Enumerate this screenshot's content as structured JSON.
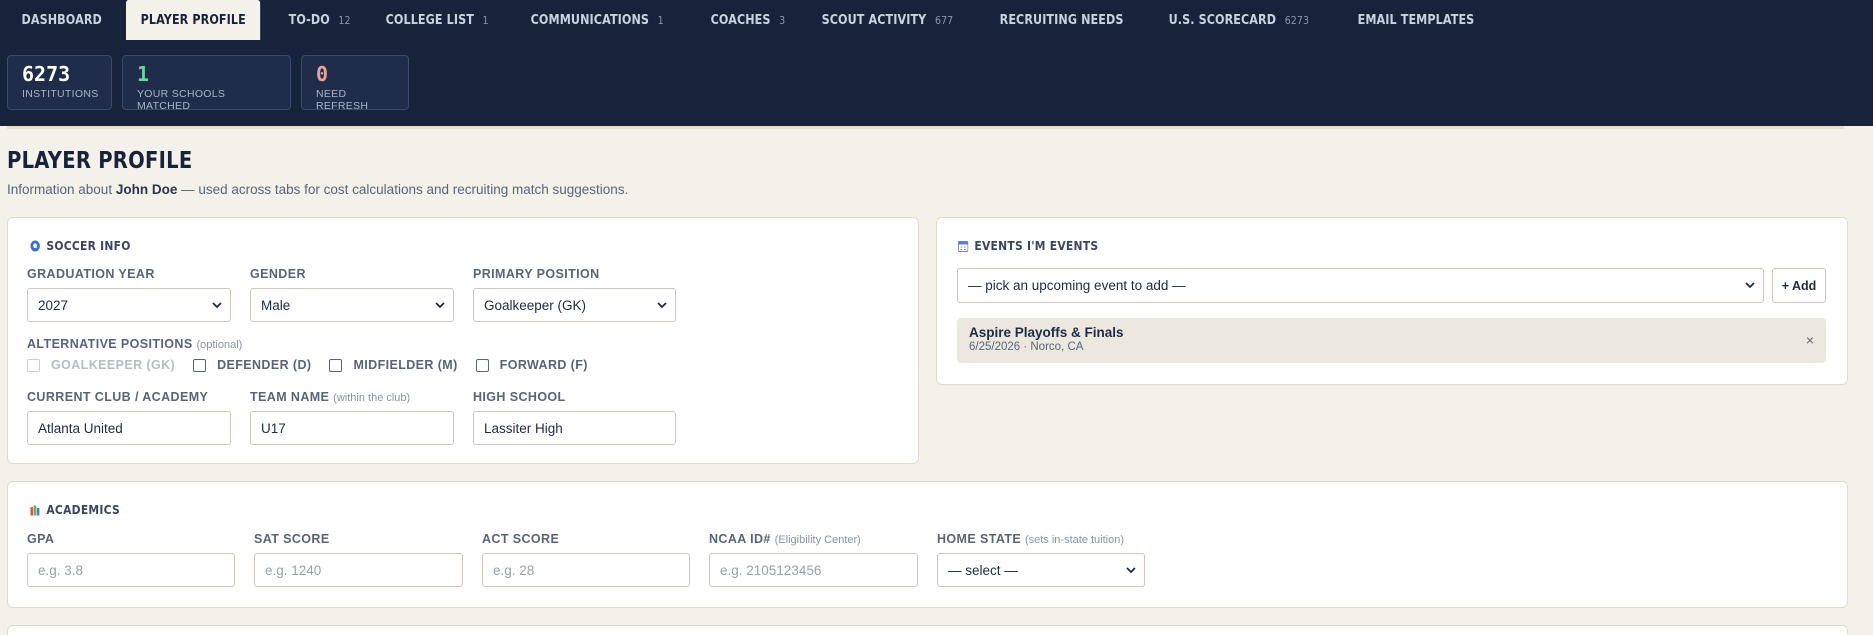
{
  "nav": {
    "tabs": [
      {
        "label": "DASHBOARD",
        "count": ""
      },
      {
        "label": "PLAYER PROFILE",
        "count": ""
      },
      {
        "label": "TO-DO",
        "count": "12"
      },
      {
        "label": "COLLEGE LIST",
        "count": "1"
      },
      {
        "label": "COMMUNICATIONS",
        "count": "1"
      },
      {
        "label": "COACHES",
        "count": "3"
      },
      {
        "label": "SCOUT ACTIVITY",
        "count": "677"
      },
      {
        "label": "RECRUITING NEEDS",
        "count": ""
      },
      {
        "label": "U.S. SCORECARD",
        "count": "6273"
      },
      {
        "label": "EMAIL TEMPLATES",
        "count": ""
      }
    ],
    "active_tab": "PLAYER PROFILE"
  },
  "stats": [
    {
      "value": "6273",
      "label": "INSTITUTIONS",
      "color": "#ffffff"
    },
    {
      "value": "1",
      "label": "YOUR SCHOOLS MATCHED",
      "color": "#6fd3a0"
    },
    {
      "value": "0",
      "label": "NEED REFRESH",
      "color": "#e8a0a0"
    }
  ],
  "page": {
    "title": "PLAYER PROFILE",
    "sub_prefix": "Information about ",
    "player_name": "John Doe",
    "sub_suffix": " — used across tabs for cost calculations and recruiting match suggestions."
  },
  "soccer": {
    "title": "SOCCER INFO",
    "icon": "soccer-ball-icon",
    "graduation_year": {
      "label": "GRADUATION YEAR",
      "value": "2027"
    },
    "gender": {
      "label": "GENDER",
      "value": "Male"
    },
    "primary_position": {
      "label": "PRIMARY POSITION",
      "value": "Goalkeeper (GK)"
    },
    "alt_positions": {
      "label": "ALTERNATIVE POSITIONS",
      "hint": "(optional)",
      "options": [
        {
          "label": "GOALKEEPER (GK)",
          "checked": false,
          "disabled": true
        },
        {
          "label": "DEFENDER (D)",
          "checked": false,
          "disabled": false
        },
        {
          "label": "MIDFIELDER (M)",
          "checked": false,
          "disabled": false
        },
        {
          "label": "FORWARD (F)",
          "checked": false,
          "disabled": false
        }
      ]
    },
    "club": {
      "label": "CURRENT CLUB / ACADEMY",
      "value": "Atlanta United"
    },
    "team": {
      "label": "TEAM NAME",
      "hint": "(within the club)",
      "value": "U17"
    },
    "high_school": {
      "label": "HIGH SCHOOL",
      "value": "Lassiter High"
    }
  },
  "events": {
    "title": "EVENTS I'M EVENTS",
    "icon": "calendar-icon",
    "picker_value": "— pick an upcoming event to add —",
    "add_label": "+ Add",
    "items": [
      {
        "name": "Aspire Playoffs & Finals",
        "meta": "6/25/2026 · Norco, CA",
        "remove": "×"
      }
    ]
  },
  "academics": {
    "title": "ACADEMICS",
    "icon": "books-icon",
    "gpa": {
      "label": "GPA",
      "placeholder": "e.g. 3.8"
    },
    "sat": {
      "label": "SAT SCORE",
      "placeholder": "e.g. 1240"
    },
    "act": {
      "label": "ACT SCORE",
      "placeholder": "e.g. 28"
    },
    "ncaa": {
      "label": "NCAA ID#",
      "hint": "(Eligibility Center)",
      "placeholder": "e.g. 2105123456"
    },
    "home_state": {
      "label": "HOME STATE",
      "hint": "(sets in-state tuition)",
      "value": "— select —"
    }
  }
}
